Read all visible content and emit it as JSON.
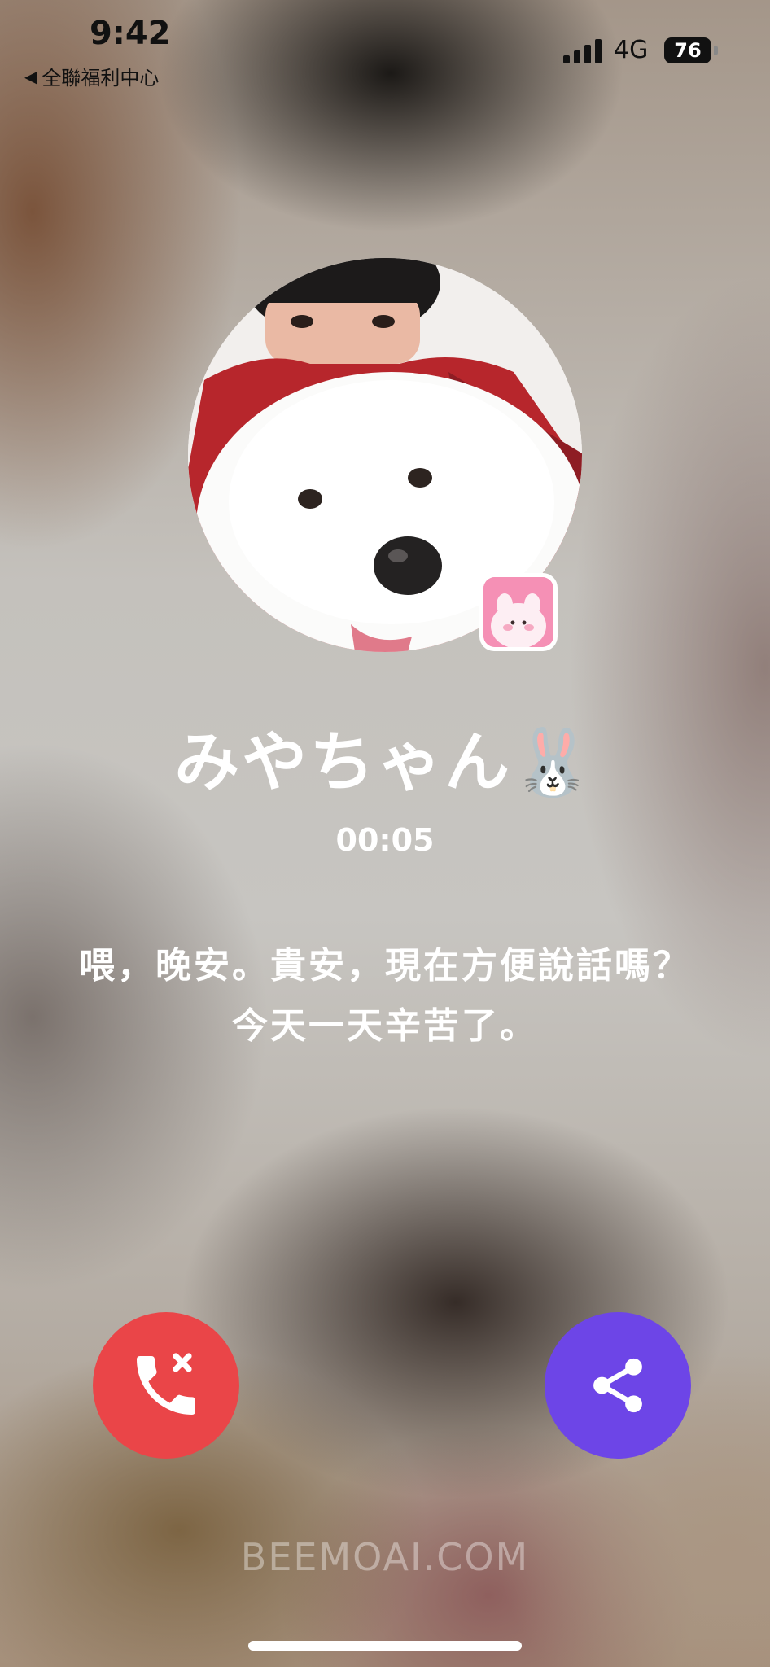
{
  "status_bar": {
    "time": "9:42",
    "back_label": "全聯福利中心",
    "network": "4G",
    "battery": "76"
  },
  "call": {
    "caller_name": "みやちゃん🐰",
    "timer": "00:05",
    "transcript_lines": [
      "喂，晚安。貴安，現在方便說話嗎？",
      "今天一天辛苦了。"
    ]
  },
  "icons": {
    "back": "back-triangle-icon",
    "signal": "signal-bars-icon",
    "battery": "battery-icon",
    "end_call": "phone-hangup-icon",
    "share": "share-icon",
    "badge": "pink-bunny-app-icon"
  },
  "colors": {
    "end_call": "#ea4548",
    "share": "#6d45e7",
    "badge": "#f590b5"
  },
  "watermark": "BEEMOAI.COM"
}
